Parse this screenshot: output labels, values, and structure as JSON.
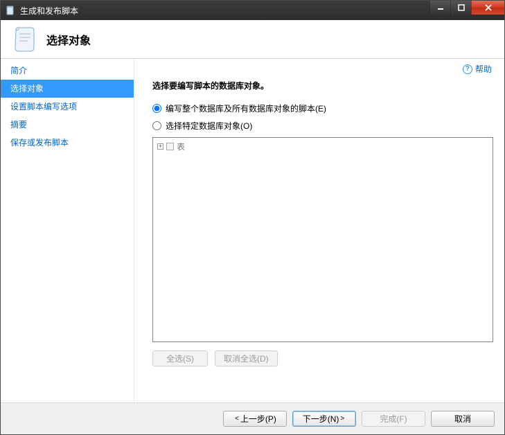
{
  "window": {
    "title": "生成和发布脚本"
  },
  "header": {
    "page_title": "选择对象"
  },
  "help": {
    "label": "帮助"
  },
  "sidebar": {
    "items": [
      {
        "label": "简介",
        "active": false
      },
      {
        "label": "选择对象",
        "active": true
      },
      {
        "label": "设置脚本编写选项",
        "active": false
      },
      {
        "label": "摘要",
        "active": false
      },
      {
        "label": "保存或发布脚本",
        "active": false
      }
    ]
  },
  "content": {
    "instruction": "选择要编写脚本的数据库对象。",
    "radios": {
      "entire": "编写整个数据库及所有数据库对象的脚本(E)",
      "specific": "选择特定数据库对象(O)",
      "selected": "entire"
    },
    "tree": {
      "root_label": "表"
    },
    "select_all": "全选(S)",
    "deselect_all": "取消全选(D)"
  },
  "footer": {
    "prev": "上一步(P)",
    "next": "下一步(N)",
    "finish": "完成(F)",
    "cancel": "取消"
  }
}
